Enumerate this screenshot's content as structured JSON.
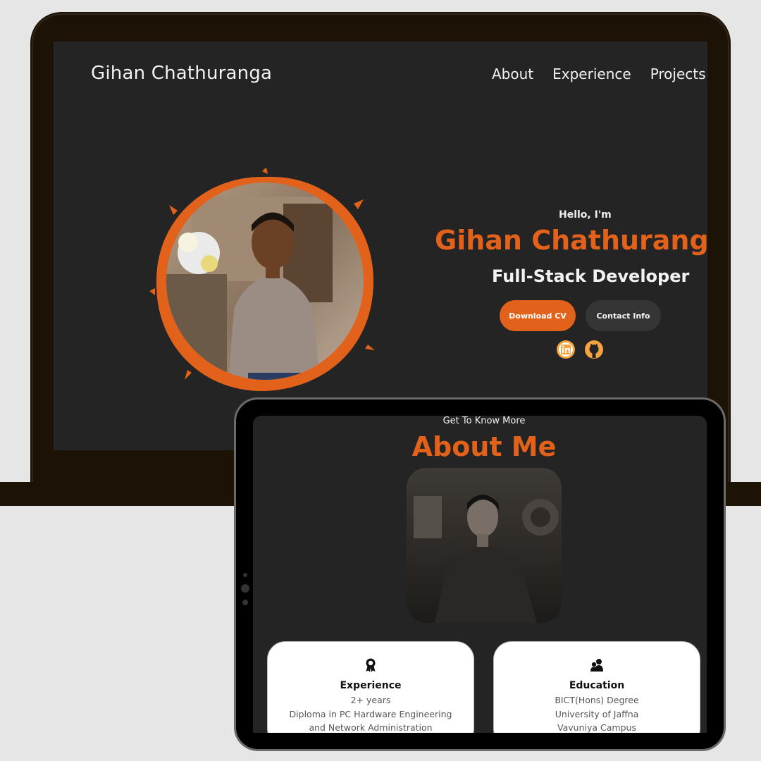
{
  "laptop_site": {
    "logo": "Gihan Chathuranga",
    "nav": [
      "About",
      "Experience",
      "Projects"
    ],
    "hero": {
      "greeting": "Hello, I'm",
      "name": "Gihan Chathurang",
      "role": "Full-Stack Developer",
      "download_cv": "Download CV",
      "contact_info": "Contact Info",
      "socials": [
        "linkedin-icon",
        "github-icon"
      ]
    }
  },
  "tablet_site": {
    "eyebrow": "Get To Know More",
    "title": "About Me",
    "cards": {
      "experience": {
        "icon": "award-icon",
        "title": "Experience",
        "lines": [
          "2+ years",
          "Diploma in PC Hardware Engineering",
          "and Network Administration"
        ]
      },
      "education": {
        "icon": "users-icon",
        "title": "Education",
        "lines": [
          "BICT(Hons) Degree",
          "University of Jaffna",
          "Vavuniya Campus"
        ]
      }
    }
  },
  "colors": {
    "accent": "#e3621b",
    "screen_bg": "#242424",
    "device_frame": "#1c1206",
    "page_bg": "#e6e6e6"
  }
}
